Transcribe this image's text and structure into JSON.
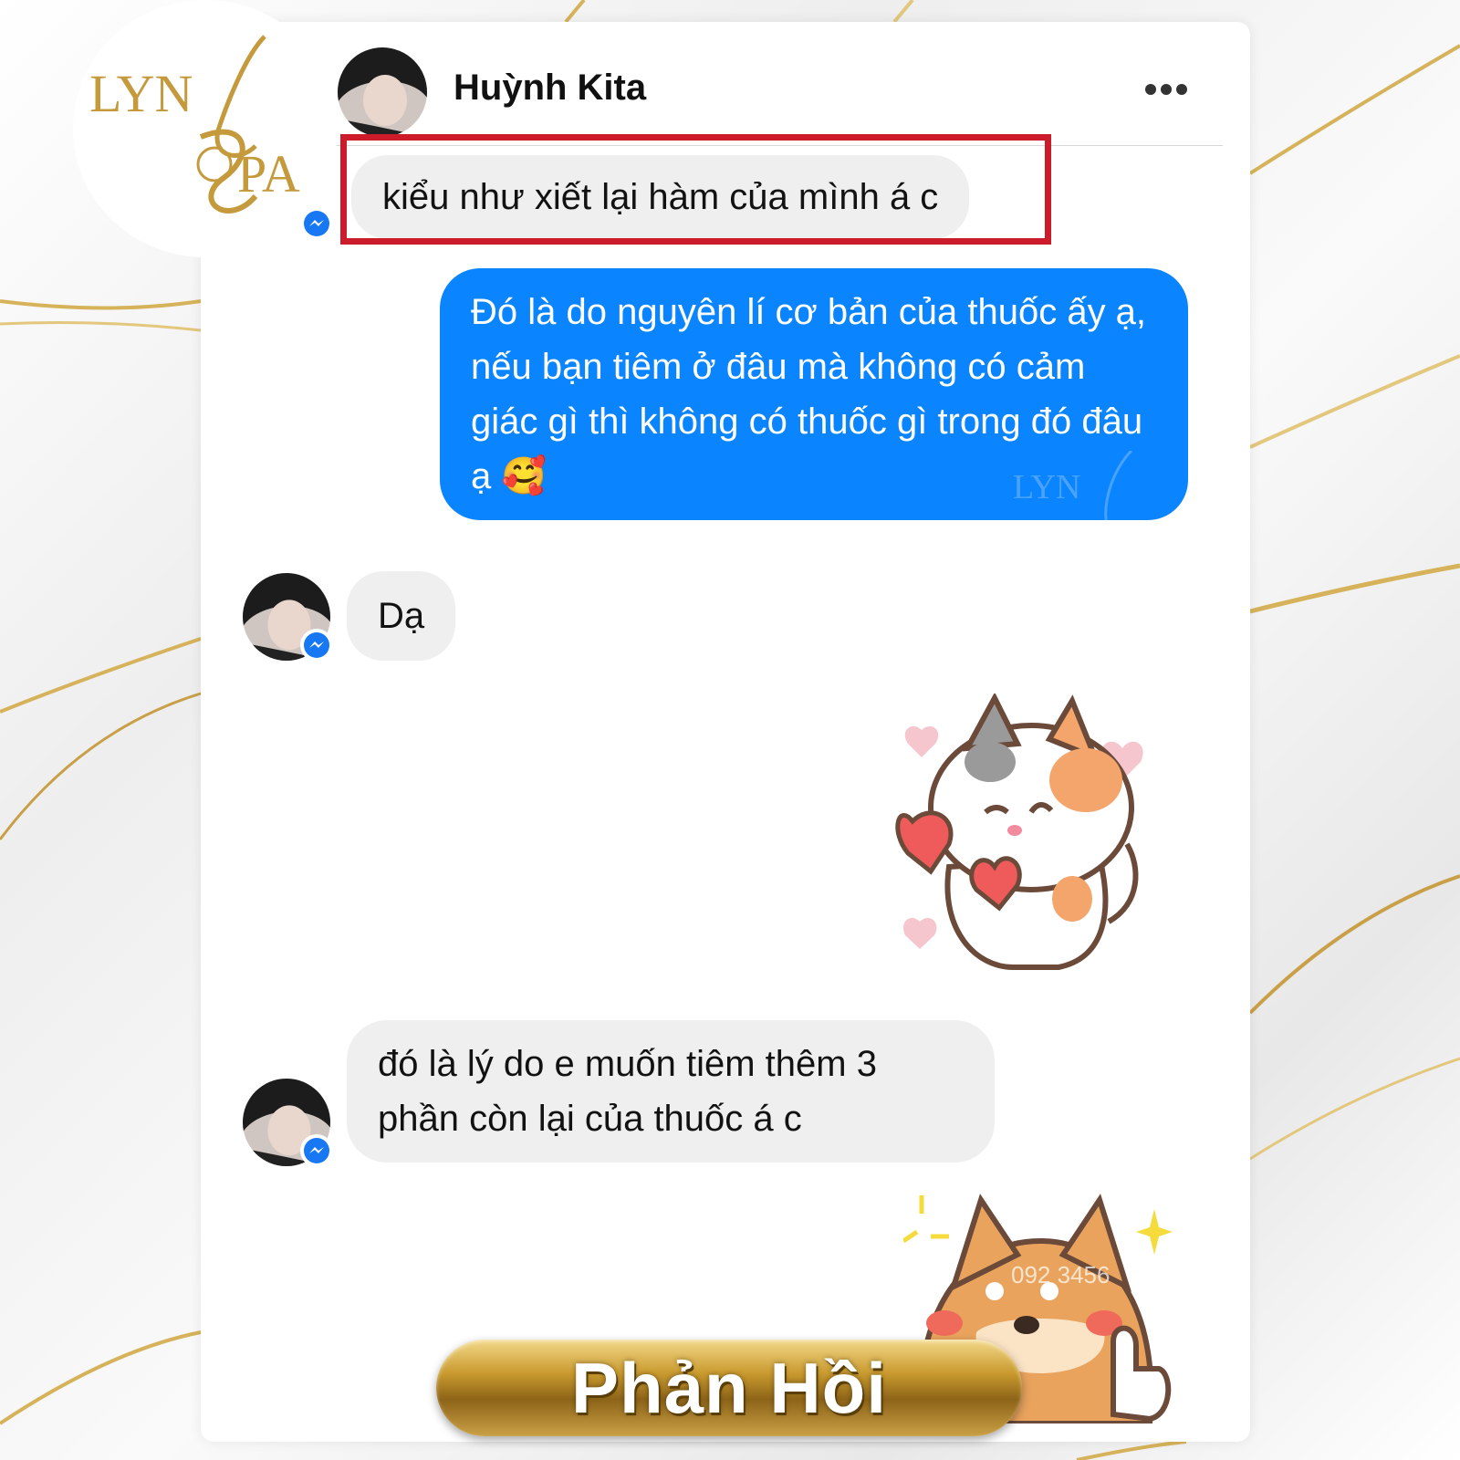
{
  "brand": {
    "logo_text_top": "LYN",
    "logo_text_bottom": "SPA",
    "logo_color": "#c49a3c"
  },
  "header": {
    "contact_name": "Huỳnh Kita",
    "more_icon": "more-horizontal-icon"
  },
  "messages": [
    {
      "from": "contact",
      "text": "kiểu như xiết lại hàm của mình á c",
      "highlighted": true
    },
    {
      "from": "me",
      "text": "Đó là do nguyên lí cơ bản của thuốc ấy ạ, nếu bạn tiêm ở đâu mà không có cảm giác gì thì không có thuốc gì trong đó đâu ạ 🥰"
    },
    {
      "from": "contact",
      "text": "Dạ"
    },
    {
      "from": "me",
      "sticker": "cat-hearts-sticker"
    },
    {
      "from": "contact",
      "text": "đó là lý do e muốn tiêm thêm 3 phần còn lại của thuốc á c"
    },
    {
      "from": "me",
      "sticker": "shiba-thumbs-up-sticker"
    }
  ],
  "watermark": {
    "text": "LYN",
    "phone": "092 3456"
  },
  "banner": {
    "label": "Phản Hồi"
  },
  "colors": {
    "outgoing_bubble": "#0a84ff",
    "incoming_bubble": "#efefef",
    "highlight": "#cc1c2c",
    "gold": "#c49a3c"
  }
}
